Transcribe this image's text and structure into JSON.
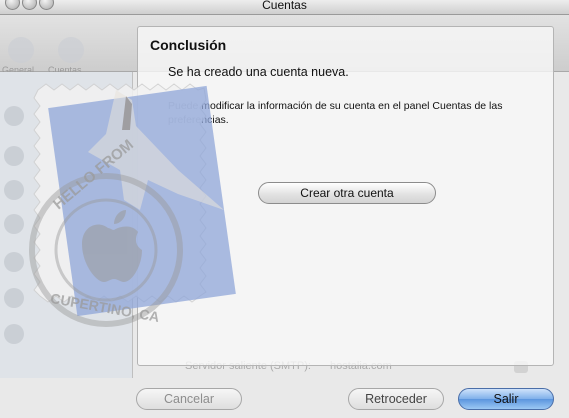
{
  "window": {
    "title": "Cuentas"
  },
  "background": {
    "toolbar_items": [
      "General",
      "Cuentas"
    ],
    "form_label": "Servidor saliente (SMTP):",
    "form_value": "hostalia.com"
  },
  "stamp": {
    "top_text": "HELLO FROM",
    "bottom_text": "CUPERTINO, CA"
  },
  "sheet": {
    "heading": "Conclusión",
    "message": "Se ha creado una cuenta nueva.",
    "detail": "Puede modificar la información de su cuenta en el panel Cuentas de las preferencias.",
    "create_another_label": "Crear otra cuenta"
  },
  "buttons": {
    "cancel": "Cancelar",
    "back": "Retroceder",
    "exit": "Salir"
  },
  "colors": {
    "default_button": "#5b95de",
    "stamp_blue": "#8fa6d8"
  },
  "icons": [
    "close-window-icon",
    "minimize-window-icon",
    "zoom-window-icon",
    "mail-stamp-icon",
    "apple-logo-icon",
    "hawk-icon"
  ]
}
